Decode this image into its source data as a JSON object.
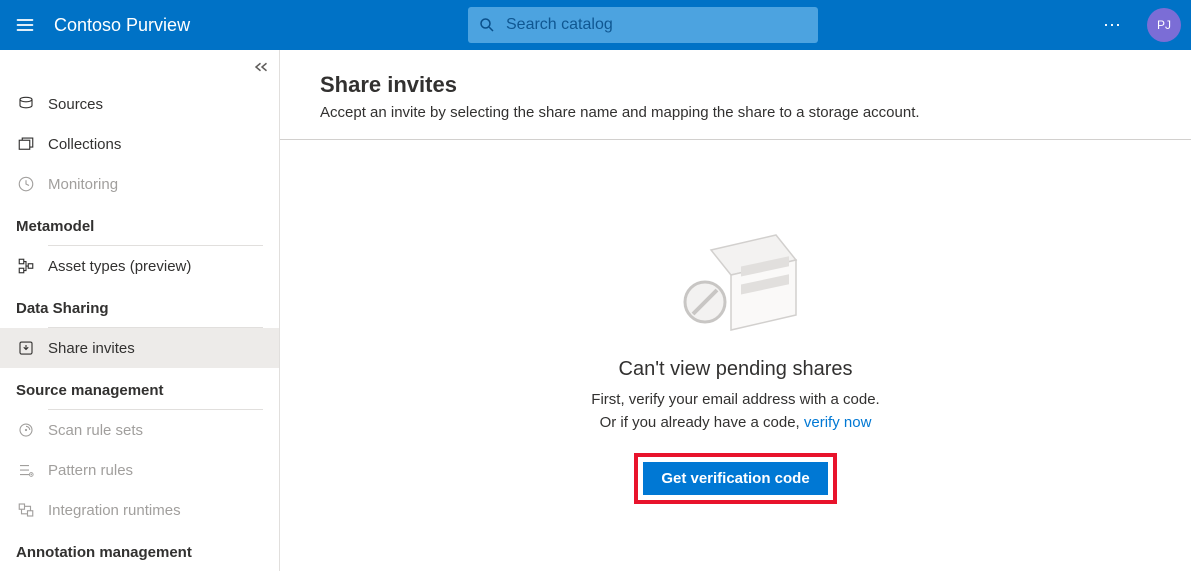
{
  "header": {
    "app_title": "Contoso Purview",
    "search_placeholder": "Search catalog",
    "avatar_initials": "PJ"
  },
  "sidebar": {
    "items": [
      {
        "label": "Sources"
      },
      {
        "label": "Collections"
      },
      {
        "label": "Monitoring"
      }
    ],
    "groups": {
      "metamodel": {
        "label": "Metamodel",
        "items": [
          {
            "label": "Asset types (preview)"
          }
        ]
      },
      "data_sharing": {
        "label": "Data Sharing",
        "items": [
          {
            "label": "Share invites"
          }
        ]
      },
      "source_mgmt": {
        "label": "Source management",
        "items": [
          {
            "label": "Scan rule sets"
          },
          {
            "label": "Pattern rules"
          },
          {
            "label": "Integration runtimes"
          }
        ]
      },
      "annotation": {
        "label": "Annotation management"
      }
    }
  },
  "main": {
    "title": "Share invites",
    "description": "Accept an invite by selecting the share name and mapping the share to a storage account.",
    "empty": {
      "title": "Can't view pending shares",
      "line1": "First, verify your email address with a code.",
      "line2_prefix": "Or if you already have a code, ",
      "verify_link": "verify now",
      "cta": "Get verification code"
    }
  }
}
